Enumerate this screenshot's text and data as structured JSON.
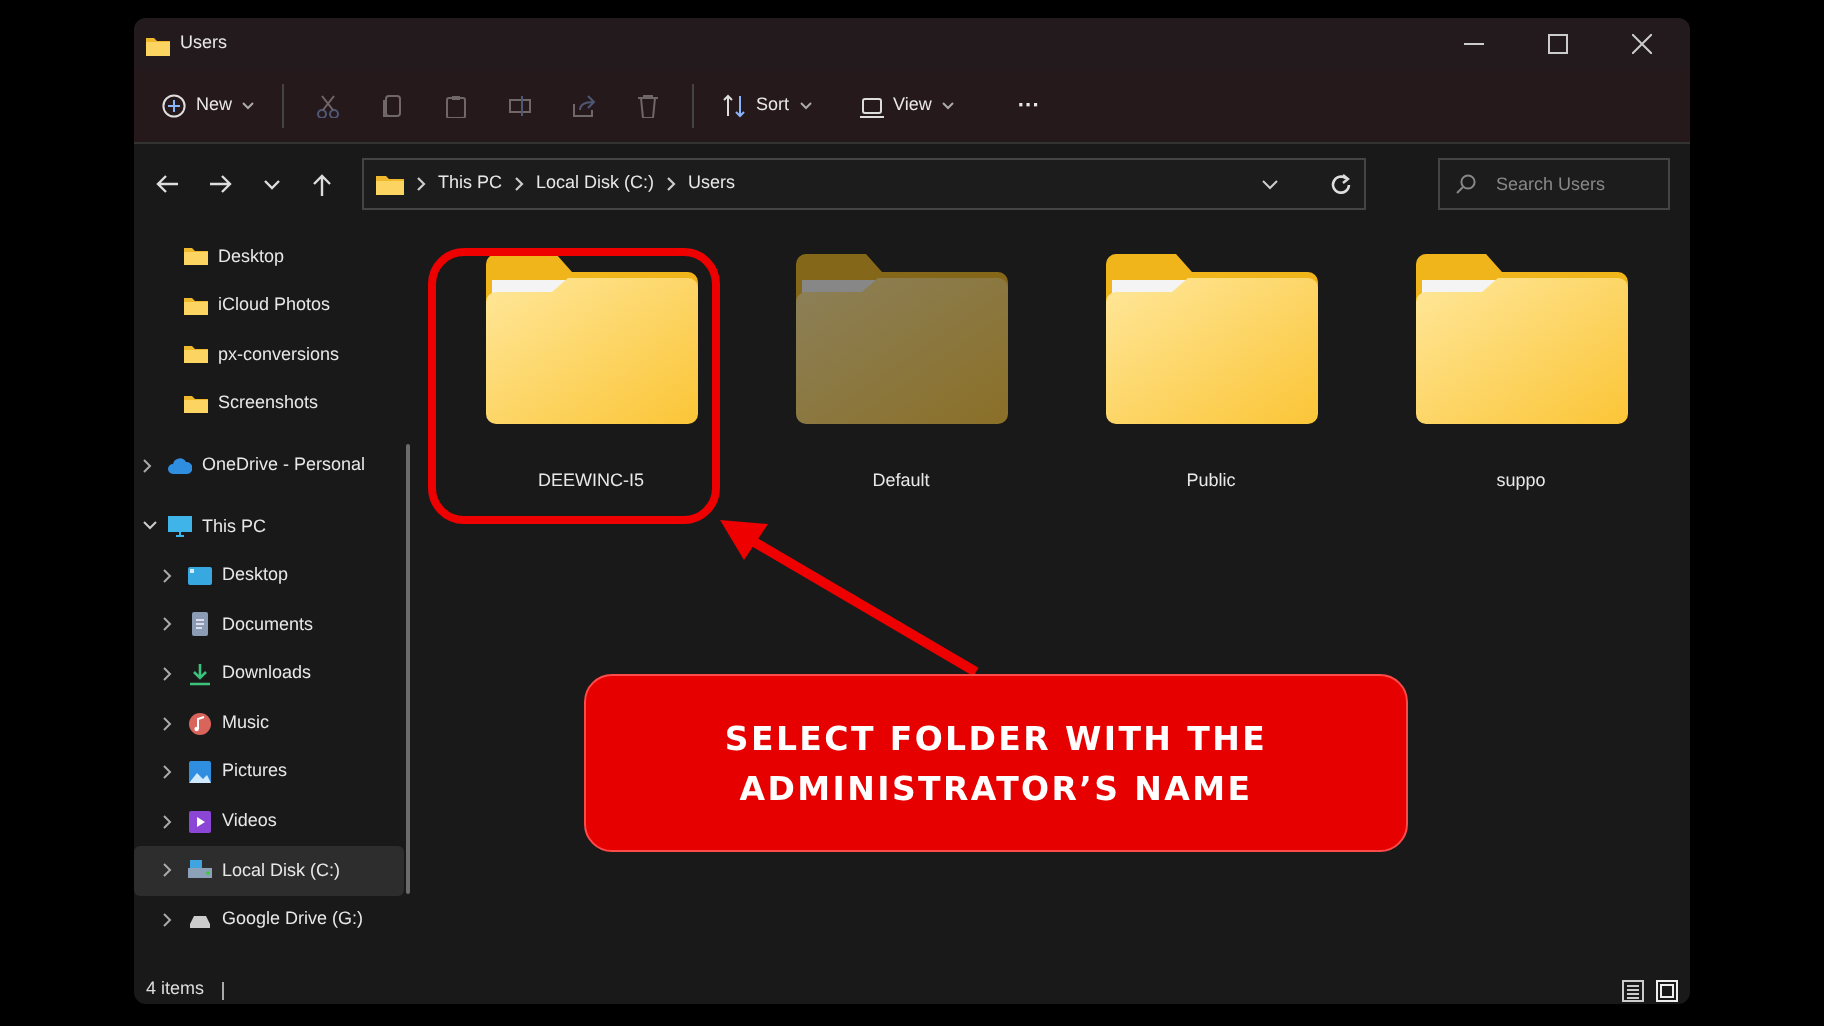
{
  "window": {
    "title": "Users"
  },
  "toolbar": {
    "new": "New",
    "sort": "Sort",
    "view": "View",
    "more": "···"
  },
  "address": {
    "breadcrumbs": [
      "This PC",
      "Local Disk (C:)",
      "Users"
    ],
    "search_placeholder": "Search Users"
  },
  "sidebar": {
    "items": [
      {
        "label": "Desktop",
        "kind": "folder",
        "selected": false
      },
      {
        "label": "iCloud Photos",
        "kind": "folder",
        "selected": false
      },
      {
        "label": "px-conversions",
        "kind": "folder",
        "selected": false
      },
      {
        "label": "Screenshots",
        "kind": "folder",
        "selected": false
      },
      {
        "label": "OneDrive - Personal",
        "kind": "cloud",
        "selected": false,
        "expanded": false
      },
      {
        "label": "This PC",
        "kind": "pc",
        "selected": false,
        "expanded": true,
        "children": [
          {
            "label": "Desktop",
            "kind": "desktop",
            "selected": false,
            "expanded": false
          },
          {
            "label": "Documents",
            "kind": "documents",
            "selected": false,
            "expanded": false
          },
          {
            "label": "Downloads",
            "kind": "downloads",
            "selected": false,
            "expanded": false
          },
          {
            "label": "Music",
            "kind": "music",
            "selected": false,
            "expanded": false
          },
          {
            "label": "Pictures",
            "kind": "pictures",
            "selected": false,
            "expanded": false
          },
          {
            "label": "Videos",
            "kind": "videos",
            "selected": false,
            "expanded": false
          },
          {
            "label": "Local Disk (C:)",
            "kind": "disk",
            "selected": true,
            "expanded": false
          },
          {
            "label": "Google Drive (G:)",
            "kind": "drive",
            "selected": false,
            "expanded": false
          }
        ]
      }
    ]
  },
  "folders": [
    {
      "name": "DEEWINC-I5",
      "hidden": false,
      "highlighted": true
    },
    {
      "name": "Default",
      "hidden": true,
      "highlighted": false
    },
    {
      "name": "Public",
      "hidden": false,
      "highlighted": false
    },
    {
      "name": "suppo",
      "hidden": false,
      "highlighted": false
    }
  ],
  "status_bar": {
    "count": "4 items"
  },
  "annotation": {
    "text": "SELECT FOLDER WITH THE ADMINISTRATOR’S NAME"
  }
}
